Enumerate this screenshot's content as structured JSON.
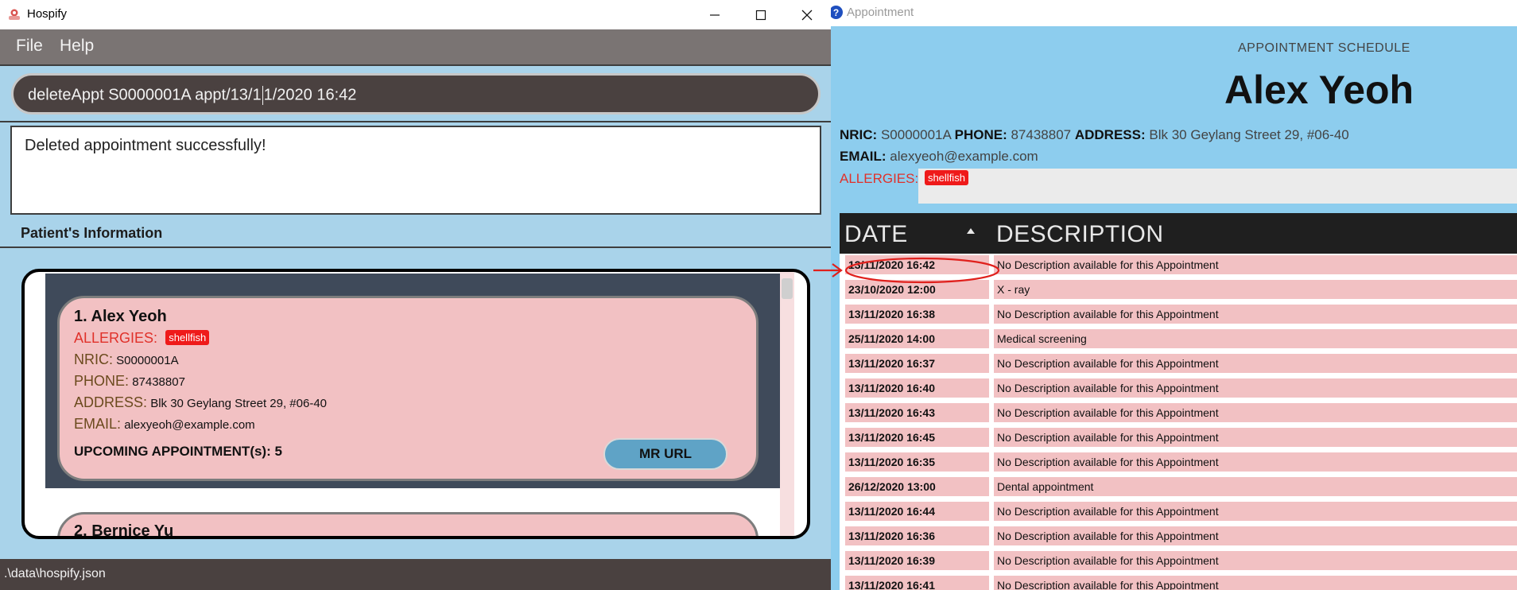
{
  "left_window": {
    "title": "Hospify",
    "menu": {
      "file": "File",
      "help": "Help"
    },
    "command": {
      "before_caret": "deleteAppt S0000001A appt/13/1",
      "after_caret": "1/2020 16:42"
    },
    "result": "Deleted appointment successfully!",
    "section_title": "Patient's Information",
    "patients": [
      {
        "index_name": "1.  Alex Yeoh",
        "allergies_label": "ALLERGIES:",
        "allergy_tag": "shellfish",
        "nric_label": "NRIC:",
        "nric": "S0000001A",
        "phone_label": "PHONE:",
        "phone": "87438807",
        "address_label": "ADDRESS:",
        "address": "Blk 30 Geylang Street 29, #06-40",
        "email_label": "EMAIL:",
        "email": "alexyeoh@example.com",
        "upcoming": "UPCOMING APPOINTMENT(s): 5",
        "mr_button": "MR URL"
      },
      {
        "index_name": "2.  Bernice Yu"
      }
    ],
    "status_path": ".\\data\\hospify.json"
  },
  "right_window": {
    "title": "Appointment",
    "help_glyph": "?",
    "schedule_label": "APPOINTMENT SCHEDULE",
    "patient_name": "Alex Yeoh",
    "nric_label": "NRIC:",
    "nric": "S0000001A",
    "phone_label": "PHONE:",
    "phone": "87438807",
    "address_label": "ADDRESS:",
    "address": "Blk 30 Geylang Street 29, #06-40",
    "email_label": "EMAIL:",
    "email": "alexyeoh@example.com",
    "allergies_label": "ALLERGIES:",
    "allergy_tag": "shellfish",
    "table": {
      "col_date": "DATE",
      "col_desc": "DESCRIPTION",
      "rows": [
        {
          "date": "13/11/2020 16:42",
          "desc": "No Description available for this Appointment"
        },
        {
          "date": "23/10/2020 12:00",
          "desc": "X - ray"
        },
        {
          "date": "13/11/2020 16:38",
          "desc": "No Description available for this Appointment"
        },
        {
          "date": "25/11/2020 14:00",
          "desc": "Medical screening"
        },
        {
          "date": "13/11/2020 16:37",
          "desc": "No Description available for this Appointment"
        },
        {
          "date": "13/11/2020 16:40",
          "desc": "No Description available for this Appointment"
        },
        {
          "date": "13/11/2020 16:43",
          "desc": "No Description available for this Appointment"
        },
        {
          "date": "13/11/2020 16:45",
          "desc": "No Description available for this Appointment"
        },
        {
          "date": "13/11/2020 16:35",
          "desc": "No Description available for this Appointment"
        },
        {
          "date": "26/12/2020 13:00",
          "desc": "Dental appointment"
        },
        {
          "date": "13/11/2020 16:44",
          "desc": "No Description available for this Appointment"
        },
        {
          "date": "13/11/2020 16:36",
          "desc": "No Description available for this Appointment"
        },
        {
          "date": "13/11/2020 16:39",
          "desc": "No Description available for this Appointment"
        },
        {
          "date": "13/11/2020 16:41",
          "desc": "No Description available for this Appointment"
        }
      ]
    }
  },
  "colors": {
    "annotation_red": "#e0201c",
    "card_pink": "#f2c1c3",
    "panel_blue": "#a9d3ea",
    "tag_red": "#ef1a1a"
  },
  "icons": {
    "app": "hospify-logo-icon",
    "help": "help-icon",
    "minimize": "minimize-icon",
    "maximize": "maximize-icon",
    "close": "close-icon"
  }
}
